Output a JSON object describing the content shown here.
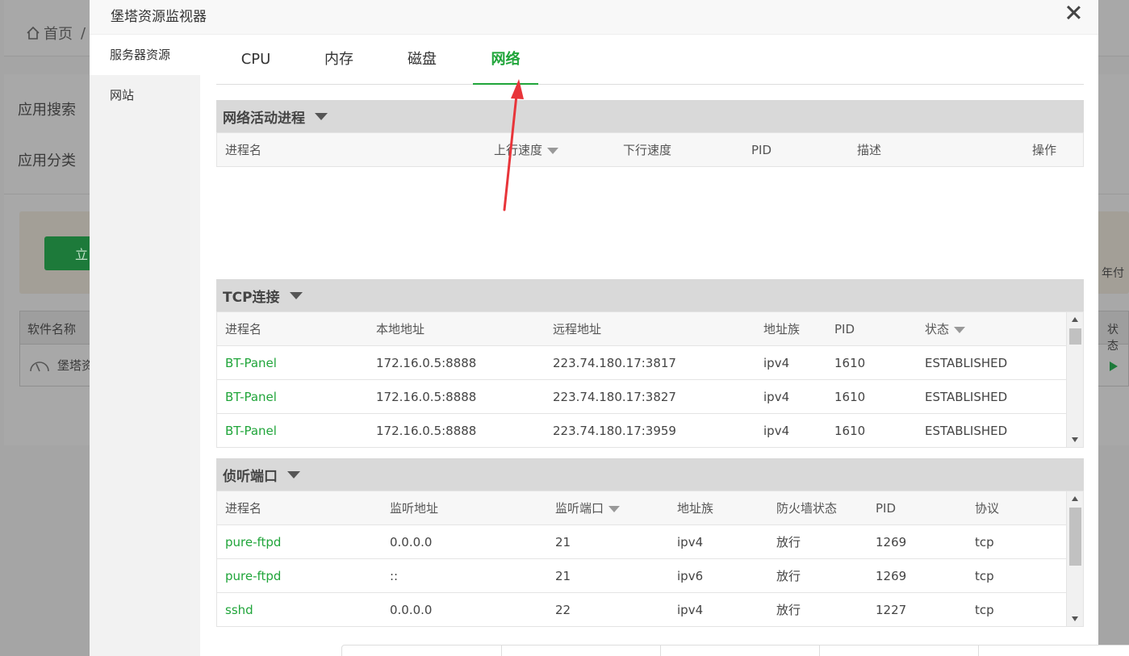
{
  "background": {
    "breadcrumb_home": "首页",
    "breadcrumb_sep": "/",
    "label_search": "应用搜索",
    "label_category": "应用分类",
    "button_partial": "立",
    "table_col_name": "软件名称",
    "row_name_partial": "堡塔资",
    "right_text_1": "年付",
    "right_text_2": "状态"
  },
  "modal": {
    "title": "堡塔资源监视器",
    "side_nav": [
      {
        "label": "服务器资源"
      },
      {
        "label": "网站"
      }
    ],
    "tabs": [
      {
        "label": "CPU"
      },
      {
        "label": "内存"
      },
      {
        "label": "磁盘"
      },
      {
        "label": "网络"
      }
    ],
    "active_tab": "网络",
    "net_process": {
      "title": "网络活动进程",
      "headers": [
        "进程名",
        "上行速度",
        "下行速度",
        "PID",
        "描述",
        "操作"
      ]
    },
    "tcp": {
      "title": "TCP连接",
      "headers": [
        "进程名",
        "本地地址",
        "远程地址",
        "地址族",
        "PID",
        "状态"
      ],
      "rows": [
        [
          "BT-Panel",
          "172.16.0.5:8888",
          "223.74.180.17:3817",
          "ipv4",
          "1610",
          "ESTABLISHED"
        ],
        [
          "BT-Panel",
          "172.16.0.5:8888",
          "223.74.180.17:3827",
          "ipv4",
          "1610",
          "ESTABLISHED"
        ],
        [
          "BT-Panel",
          "172.16.0.5:8888",
          "223.74.180.17:3959",
          "ipv4",
          "1610",
          "ESTABLISHED"
        ]
      ]
    },
    "listen": {
      "title": "侦听端口",
      "headers": [
        "进程名",
        "监听地址",
        "监听端口",
        "地址族",
        "防火墙状态",
        "PID",
        "协议"
      ],
      "rows": [
        [
          "pure-ftpd",
          "0.0.0.0",
          "21",
          "ipv4",
          "放行",
          "1269",
          "tcp"
        ],
        [
          "pure-ftpd",
          "::",
          "21",
          "ipv6",
          "放行",
          "1269",
          "tcp"
        ],
        [
          "sshd",
          "0.0.0.0",
          "22",
          "ipv4",
          "放行",
          "1227",
          "tcp"
        ]
      ]
    }
  },
  "colors": {
    "accent": "#20a53a",
    "annotation_arrow": "#e8353a"
  }
}
